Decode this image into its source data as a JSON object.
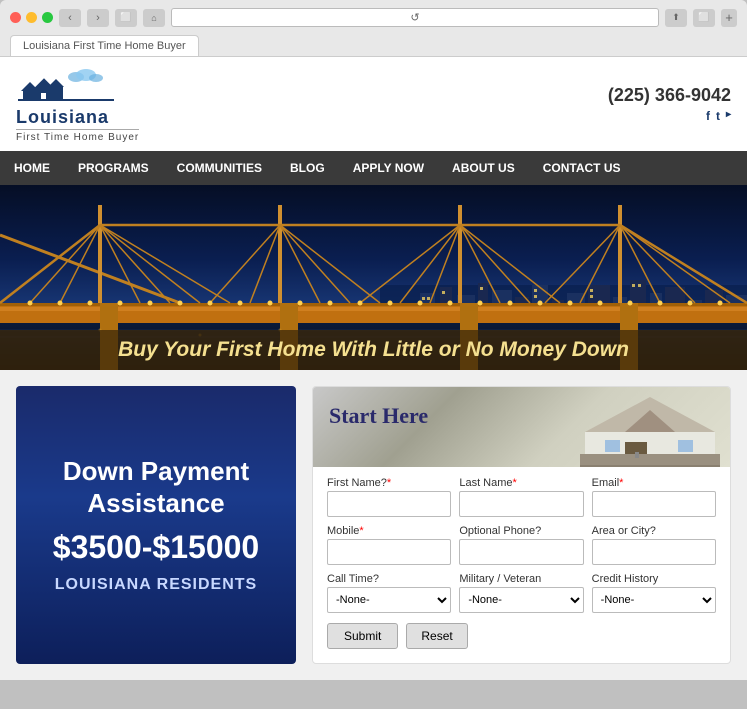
{
  "browser": {
    "tab_label": "Louisiana First Time Home Buyer",
    "reload_icon": "↺",
    "back_icon": "‹",
    "forward_icon": "›"
  },
  "header": {
    "logo_title": "Louisiana",
    "logo_subtitle": "First Time Home Buyer",
    "phone": "(225) 366-9042",
    "social": [
      "f",
      "t",
      "rss"
    ]
  },
  "nav": {
    "items": [
      {
        "label": "HOME",
        "id": "home"
      },
      {
        "label": "PROGRAMS",
        "id": "programs"
      },
      {
        "label": "COMMUNITIES",
        "id": "communities"
      },
      {
        "label": "BLOG",
        "id": "blog"
      },
      {
        "label": "APPLY NOW",
        "id": "apply-now"
      },
      {
        "label": "ABOUT US",
        "id": "about-us"
      },
      {
        "label": "CONTACT US",
        "id": "contact-us"
      }
    ]
  },
  "hero": {
    "tagline": "Buy Your First Home With Little or No Money Down"
  },
  "dpa": {
    "title": "Down Payment Assistance",
    "amount": "$3500-$15000",
    "subtitle": "LOUISIANA RESIDENTS"
  },
  "form": {
    "title": "Start Here",
    "fields": [
      {
        "label": "First Name?",
        "required": true,
        "id": "first-name",
        "type": "text"
      },
      {
        "label": "Last Name",
        "required": true,
        "id": "last-name",
        "type": "text"
      },
      {
        "label": "Email",
        "required": true,
        "id": "email",
        "type": "text"
      },
      {
        "label": "Mobile",
        "required": true,
        "id": "mobile",
        "type": "text"
      },
      {
        "label": "Optional Phone?",
        "required": false,
        "id": "optional-phone",
        "type": "text"
      },
      {
        "label": "Area or City?",
        "required": false,
        "id": "area-city",
        "type": "text"
      },
      {
        "label": "Call Time?",
        "required": false,
        "id": "call-time",
        "type": "select"
      },
      {
        "label": "Military / Veteran",
        "required": false,
        "id": "military",
        "type": "select"
      },
      {
        "label": "Credit History",
        "required": false,
        "id": "credit",
        "type": "select"
      }
    ],
    "select_default": "-None-",
    "submit_label": "Submit",
    "reset_label": "Reset"
  }
}
